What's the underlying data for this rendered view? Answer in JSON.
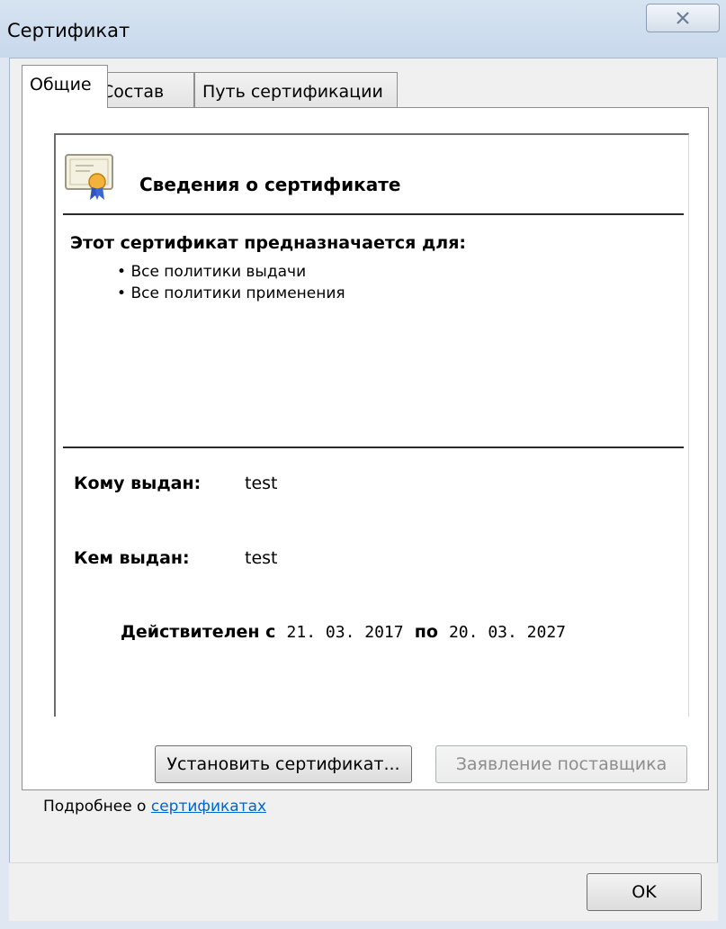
{
  "window": {
    "title": "Сертификат"
  },
  "tabs": [
    {
      "label": "Общие",
      "active": true
    },
    {
      "label": "Состав",
      "active": false
    },
    {
      "label": "Путь сертификации",
      "active": false
    }
  ],
  "info": {
    "heading": "Сведения о сертификате",
    "purpose_title": "Этот сертификат предназначается для:",
    "purposes": [
      "Все политики выдачи",
      "Все политики применения"
    ],
    "issued_to_label": "Кому выдан:",
    "issued_to_value": "test",
    "issued_by_label": "Кем выдан:",
    "issued_by_value": "test",
    "valid_from_label": "Действителен с",
    "valid_from_value": "21. 03. 2017",
    "valid_to_label": "по",
    "valid_to_value": "20. 03. 2027"
  },
  "buttons": {
    "install_label": "Установить сертификат...",
    "issuer_statement_label": "Заявление поставщика",
    "ok_label": "OK"
  },
  "footer": {
    "more_prefix": "Подробнее о ",
    "more_link": "сертификатах"
  },
  "icons": {
    "close": "close-icon",
    "certificate": "certificate-icon"
  }
}
